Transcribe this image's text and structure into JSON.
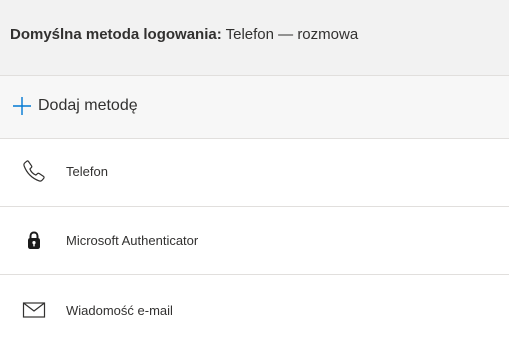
{
  "default_method": {
    "label": "Domyślna metoda logowania:",
    "value": "Telefon — rozmowa"
  },
  "add_method": {
    "label": "Dodaj metodę",
    "icon": "plus-icon",
    "accent": "#0078d4"
  },
  "methods": [
    {
      "label": "Telefon",
      "icon": "phone-icon"
    },
    {
      "label": "Microsoft Authenticator",
      "icon": "authenticator-lock-icon"
    },
    {
      "label": "Wiadomość e-mail",
      "icon": "mail-icon"
    }
  ]
}
